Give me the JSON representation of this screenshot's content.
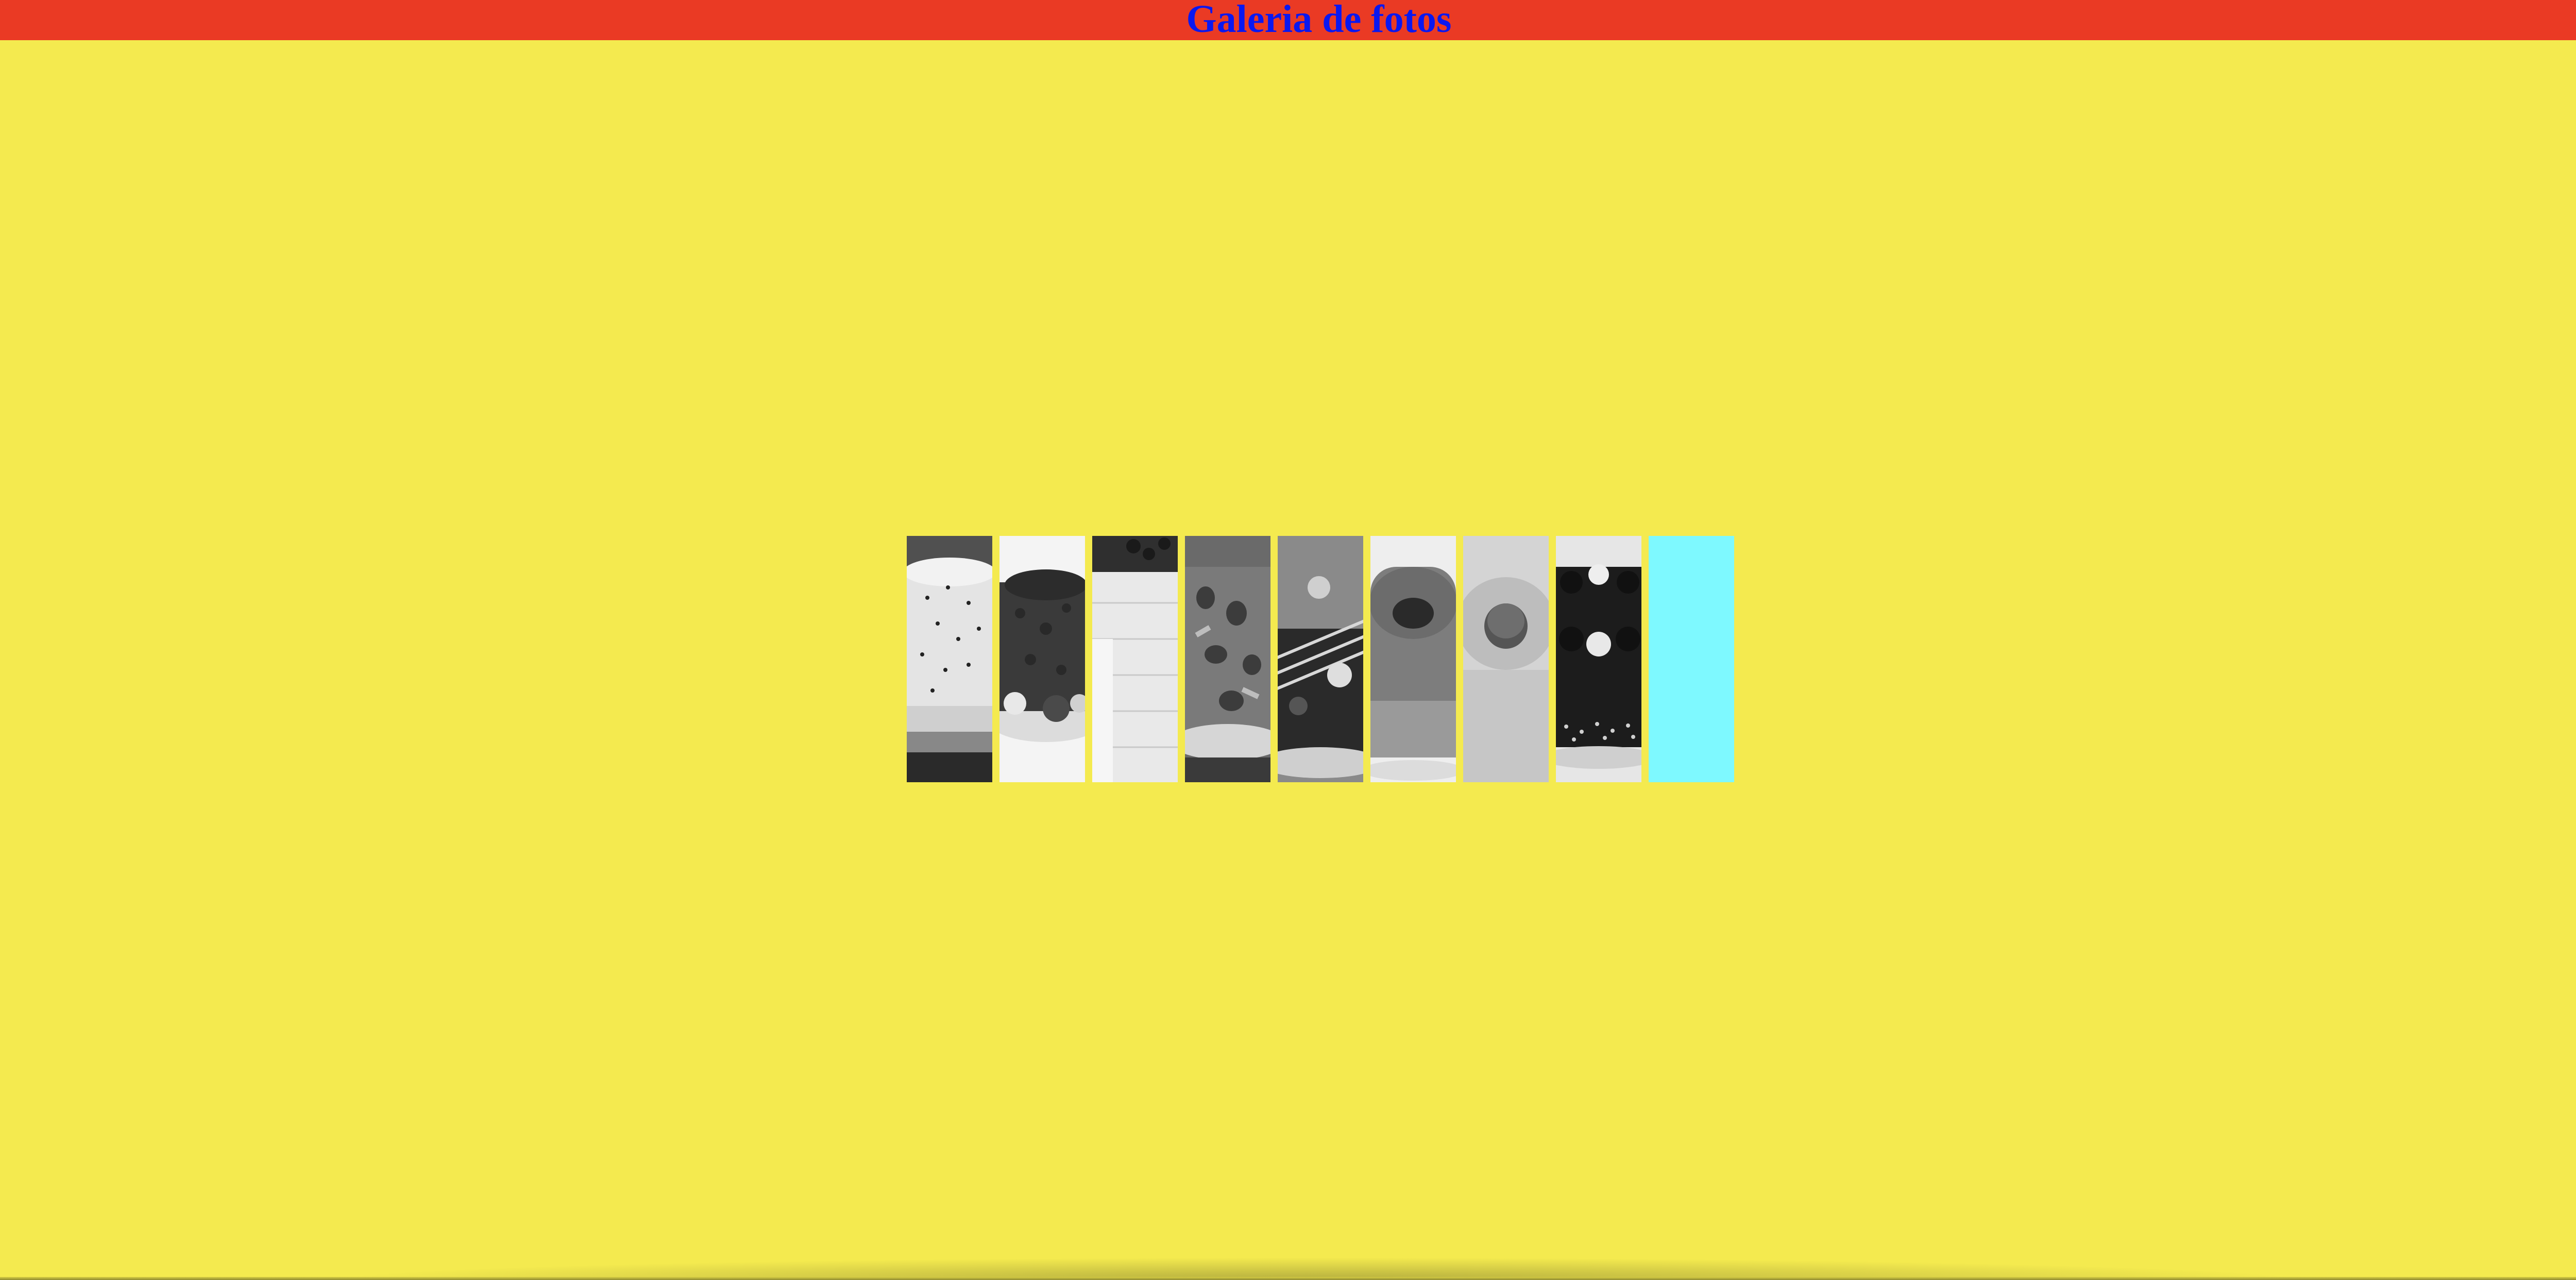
{
  "header": {
    "title": "Galeria de fotos"
  },
  "colors": {
    "background": "#f4ea4f",
    "header_bar": "#ea3a24",
    "title_text": "#0a18f0",
    "empty_tile": "#7ef9ff"
  },
  "gallery": {
    "photos": [
      {
        "icon": "cheesecake-photo"
      },
      {
        "icon": "chocolate-cake-photo"
      },
      {
        "icon": "white-layer-cake-photo"
      },
      {
        "icon": "strawberry-chocolate-tart-photo"
      },
      {
        "icon": "chocolate-drizzle-cake-photo"
      },
      {
        "icon": "bundt-cake-photo"
      },
      {
        "icon": "plain-sponge-cake-photo"
      },
      {
        "icon": "chocolate-truffle-cake-photo"
      },
      {
        "icon": "empty-placeholder"
      }
    ]
  }
}
